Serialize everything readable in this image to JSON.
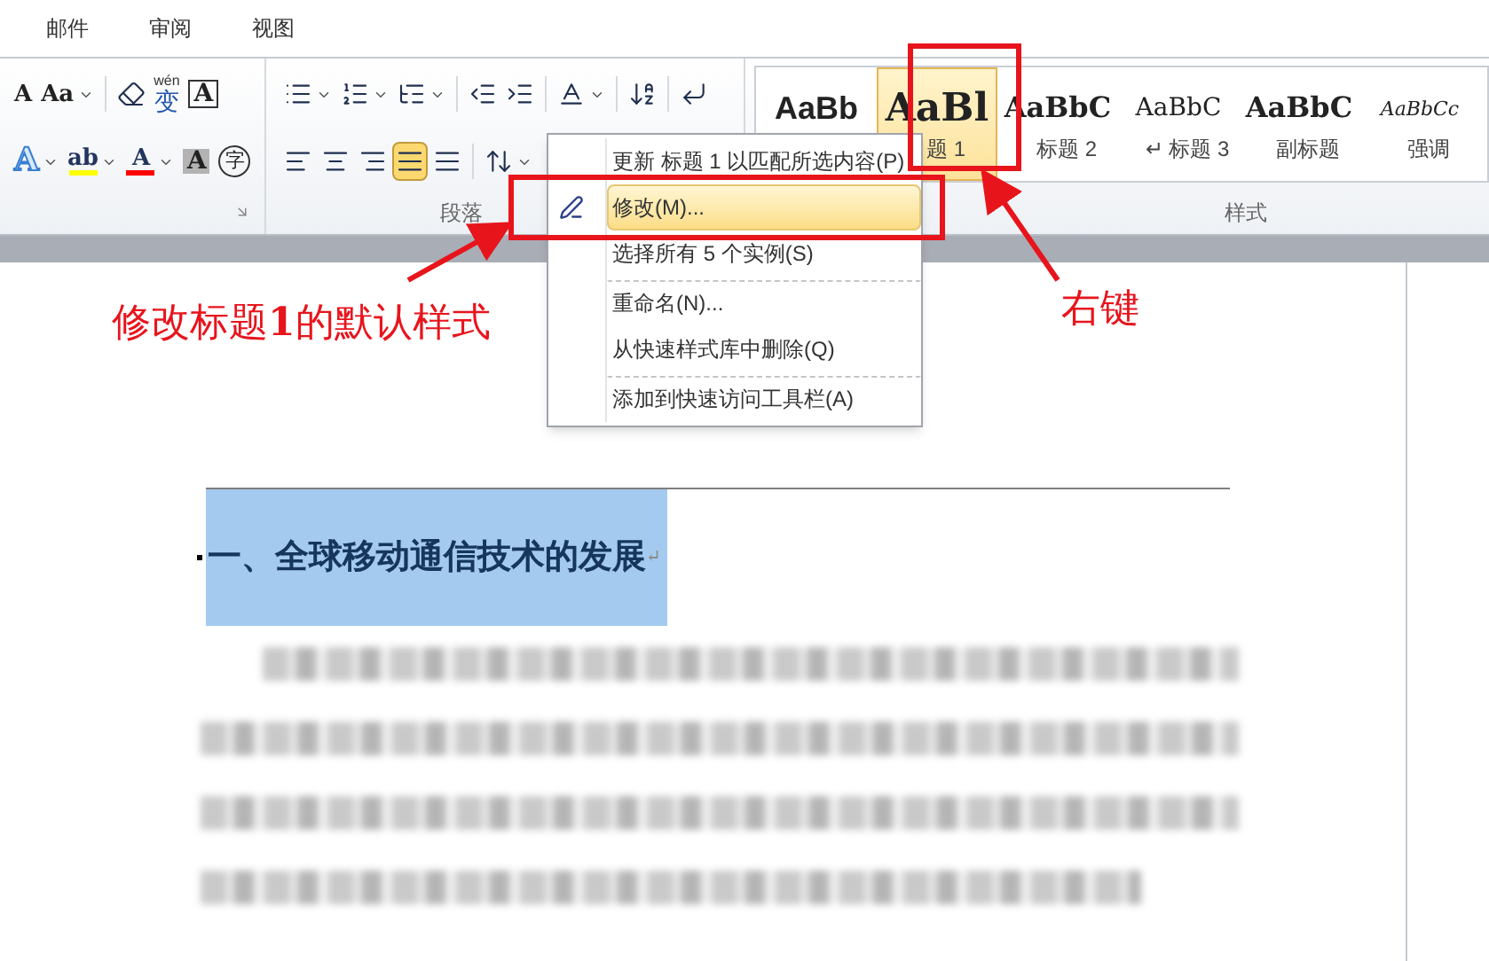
{
  "tabs": [
    {
      "label": "邮件",
      "selected": false
    },
    {
      "label": "审阅",
      "selected": false
    },
    {
      "label": "视图",
      "selected": false
    }
  ],
  "ribbon": {
    "font_group": {
      "launcher": true,
      "rows": [
        [
          {
            "kind": "glyph",
            "glyph": "A",
            "dropdown": false,
            "selected": false
          },
          {
            "kind": "glyph",
            "glyph": "Aa",
            "dropdown": true,
            "selected": false
          },
          {
            "kind": "separator"
          },
          {
            "kind": "eraser",
            "dropdown": false,
            "selected": false
          },
          {
            "kind": "glyph-ruby",
            "glyph": "变",
            "ruby": "wén",
            "dropdown": false,
            "selected": false
          },
          {
            "kind": "glyph-boxed",
            "glyph": "A",
            "dropdown": false,
            "selected": false
          }
        ],
        [
          {
            "kind": "glyph-outline",
            "glyph": "A",
            "dropdown": true,
            "selected": false
          },
          {
            "kind": "glyph-color-bar",
            "glyph": "ab",
            "color": "#ffff00",
            "dropdown": true,
            "selected": false
          },
          {
            "kind": "glyph-color-bar",
            "glyph": "A",
            "color": "#ff0000",
            "dropdown": true,
            "selected": false
          },
          {
            "kind": "glyph-shaded",
            "glyph": "A",
            "dropdown": false,
            "selected": false
          },
          {
            "kind": "glyph-circled",
            "glyph": "字",
            "dropdown": false,
            "selected": false
          }
        ]
      ]
    },
    "paragraph_group": {
      "label": "段落",
      "rows": [
        [
          {
            "kind": "bullets",
            "dropdown": true,
            "selected": false
          },
          {
            "kind": "numbering",
            "dropdown": true,
            "selected": false
          },
          {
            "kind": "multilevel",
            "dropdown": true,
            "selected": false
          },
          {
            "kind": "separator"
          },
          {
            "kind": "outdent",
            "dropdown": false,
            "selected": false
          },
          {
            "kind": "indent",
            "dropdown": false,
            "selected": false
          },
          {
            "kind": "separator"
          },
          {
            "kind": "asian-layout",
            "dropdown": true,
            "selected": false
          },
          {
            "kind": "separator"
          },
          {
            "kind": "sort",
            "dropdown": false,
            "selected": false
          },
          {
            "kind": "separator"
          },
          {
            "kind": "pilcrow",
            "dropdown": false,
            "selected": false
          }
        ],
        [
          {
            "kind": "align-left",
            "dropdown": false,
            "selected": false
          },
          {
            "kind": "align-center",
            "dropdown": false,
            "selected": false
          },
          {
            "kind": "align-right",
            "dropdown": false,
            "selected": false
          },
          {
            "kind": "justify",
            "dropdown": false,
            "selected": true
          },
          {
            "kind": "distribute",
            "dropdown": false,
            "selected": false
          },
          {
            "kind": "separator"
          },
          {
            "kind": "line-spacing",
            "dropdown": true,
            "selected": false
          }
        ]
      ]
    },
    "styles_group": {
      "label": "样式",
      "gallery": [
        {
          "kind": "sans-bold",
          "preview": "AaBb",
          "selected": false
        },
        {
          "kind": "serif-large",
          "preview": "AaBl",
          "label": "题 1",
          "selected": true
        },
        {
          "kind": "serif-bold",
          "preview": "AaBbC",
          "label": "标题 2",
          "selected": false
        },
        {
          "kind": "serif",
          "preview": "AaBbC",
          "label": "↵ 标题 3",
          "selected": false
        },
        {
          "kind": "serif-bold",
          "preview": "AaBbC",
          "label": "副标题",
          "selected": false
        },
        {
          "kind": "serif-italic",
          "preview": "AaBbCc",
          "label": "强调",
          "selected": false
        }
      ]
    }
  },
  "context_menu": {
    "items": [
      {
        "kind": "plain",
        "label": "更新 标题 1 以匹配所选内容(P)",
        "selected": false,
        "separator_before": false
      },
      {
        "kind": "icon",
        "label": "修改(M)...",
        "selected": true,
        "separator_before": false
      },
      {
        "kind": "plain",
        "label": "选择所有 5 个实例(S)",
        "selected": false,
        "separator_before": false
      },
      {
        "kind": "plain",
        "label": "重命名(N)...",
        "selected": false,
        "separator_before": true
      },
      {
        "kind": "plain",
        "label": "从快速样式库中删除(Q)",
        "selected": false,
        "separator_before": false
      },
      {
        "kind": "plain",
        "label": "添加到快速访问工具栏(A)",
        "selected": false,
        "separator_before": true
      }
    ]
  },
  "document": {
    "heading": "一、全球移动通信技术的发展",
    "heading_selected": true,
    "paragraph_mark": "↵"
  },
  "annotations": {
    "labels": [
      "修改标题**1**的默认样式",
      "右键"
    ]
  }
}
